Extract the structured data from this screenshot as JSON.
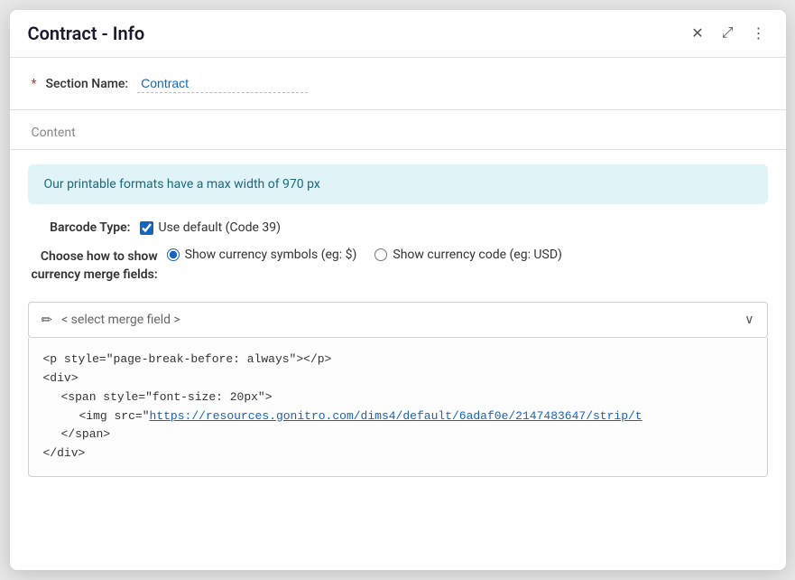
{
  "dialog": {
    "title": "Contract - Info",
    "close_icon": "✕",
    "minimize_icon": "⤢",
    "more_icon": "⋮"
  },
  "section_name": {
    "label": "Section Name:",
    "required_star": "*",
    "value": "Contract"
  },
  "content": {
    "label": "Content"
  },
  "info_banner": {
    "text": "Our printable formats have a max width of 970 px"
  },
  "barcode": {
    "label": "Barcode Type:",
    "checkbox_label": "Use default (Code 39)",
    "checked": true
  },
  "currency": {
    "label": "Choose how to show currency merge fields:",
    "option1_label": "Show currency symbols (eg: $)",
    "option2_label": "Show currency code (eg: USD)",
    "selected": "option1"
  },
  "merge_field": {
    "placeholder": "< select merge field >",
    "pencil_icon": "✏",
    "chevron_icon": "∨"
  },
  "code_block": {
    "line1": "<p style=\"page-break-before: always\"></p>",
    "line2": "<div>",
    "line3": "    <span style=\"font-size: 20px\">",
    "line4_prefix": "        <img src=\"",
    "line4_link": "https://resources.gonitro.com/dims4/default/6adaf0e/2147483647/strip/t",
    "line5": "    </span>",
    "line6": "</div>"
  }
}
